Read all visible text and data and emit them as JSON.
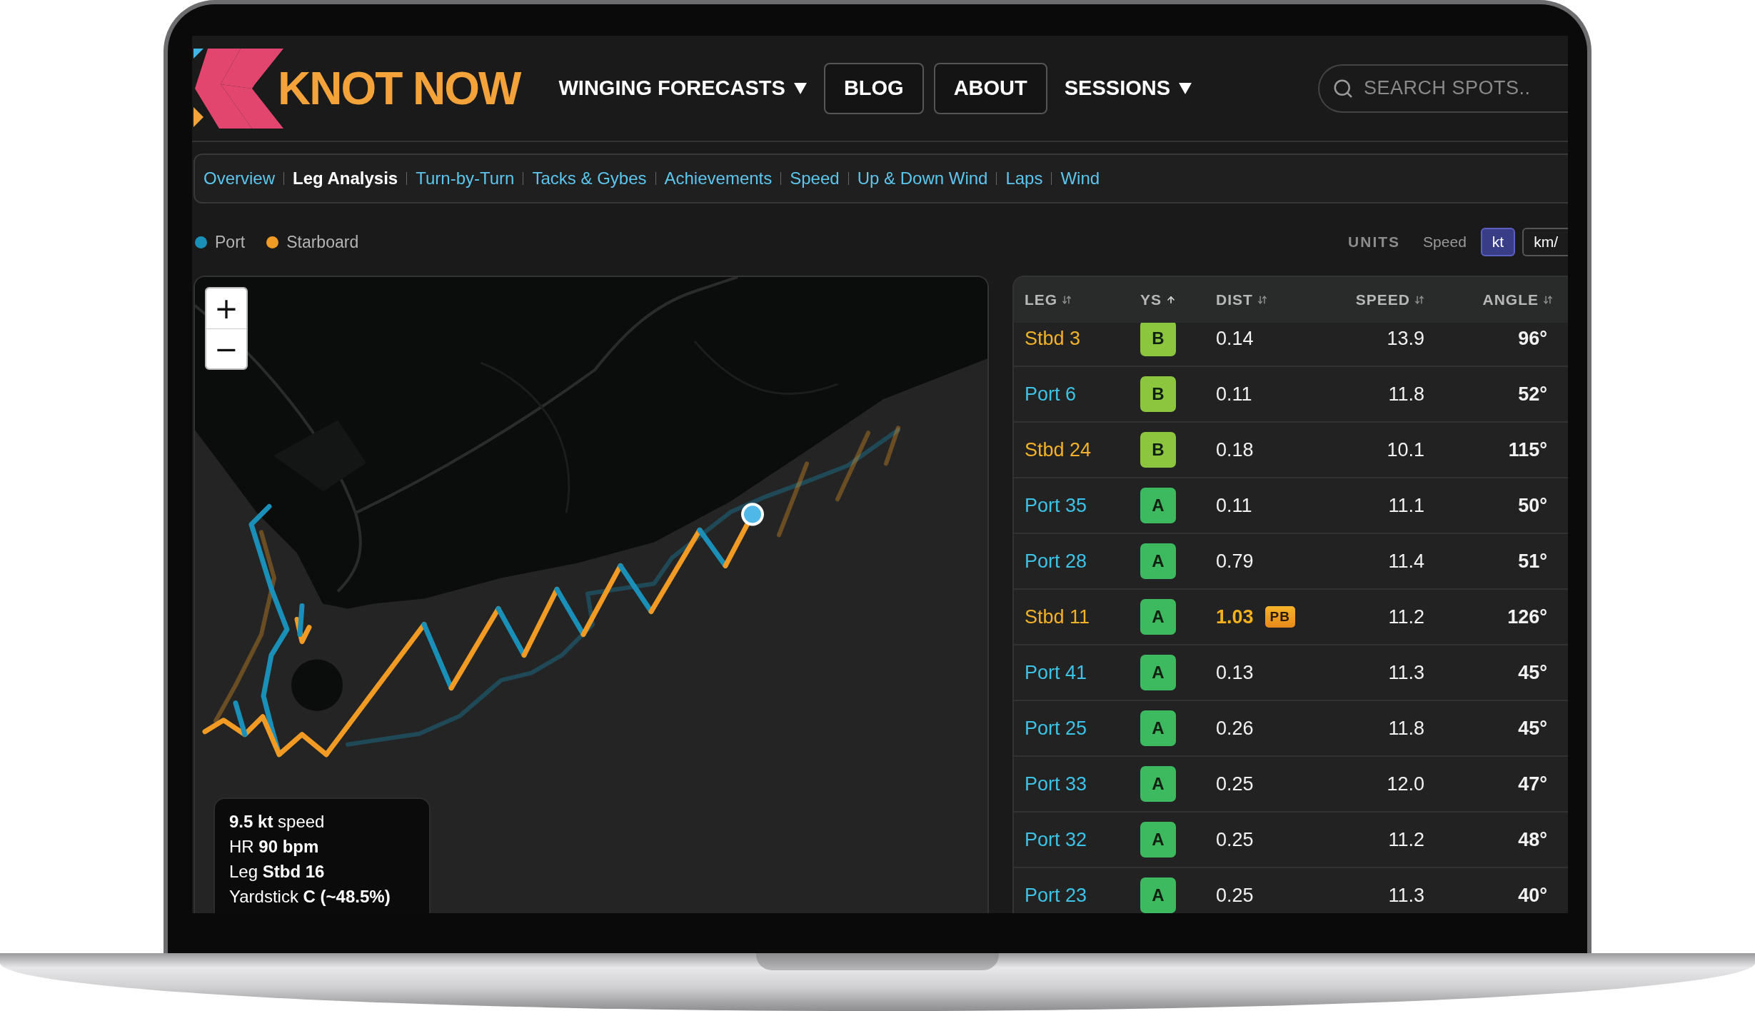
{
  "brand": {
    "name": "KNOT NOW"
  },
  "nav": [
    {
      "label": "WINGING FORECASTS",
      "kind": "menu"
    },
    {
      "label": "BLOG",
      "kind": "button"
    },
    {
      "label": "ABOUT",
      "kind": "button"
    },
    {
      "label": "SESSIONS",
      "kind": "menu"
    }
  ],
  "search": {
    "placeholder": "SEARCH SPOTS.."
  },
  "tabs": [
    {
      "label": "Overview",
      "selected": false
    },
    {
      "label": "Leg Analysis",
      "selected": true
    },
    {
      "label": "Turn-by-Turn",
      "selected": false
    },
    {
      "label": "Tacks & Gybes",
      "selected": false
    },
    {
      "label": "Achievements",
      "selected": false
    },
    {
      "label": "Speed",
      "selected": false
    },
    {
      "label": "Up & Down Wind",
      "selected": false
    },
    {
      "label": "Laps",
      "selected": false
    },
    {
      "label": "Wind",
      "selected": false
    }
  ],
  "legend": [
    {
      "label": "Port",
      "color": "#1a90b8"
    },
    {
      "label": "Starboard",
      "color": "#f29b24"
    }
  ],
  "units": {
    "label": "UNITS",
    "field": "Speed",
    "options": [
      {
        "label": "kt",
        "selected": true
      },
      {
        "label": "km/",
        "selected": false
      }
    ]
  },
  "map": {
    "zoom_in": "+",
    "zoom_out": "−",
    "info": [
      "**9.5 kt** speed",
      "HR **90 bpm**",
      "Leg **Stbd 16**",
      "Yardstick **C (~48.5%)**"
    ]
  },
  "table": {
    "columns": [
      {
        "label": "LEG",
        "sorted": false
      },
      {
        "label": "YS",
        "sorted": true
      },
      {
        "label": "DIST",
        "sorted": false
      },
      {
        "label": "SPEED",
        "sorted": false
      },
      {
        "label": "ANGLE",
        "sorted": false
      }
    ],
    "rows": [
      {
        "leg": "Stbd 3",
        "starboard": true,
        "ys": {
          "grade": "B",
          "color": "#8cc63f"
        },
        "dist": "0.14",
        "speed": "13.9",
        "angle": "96°"
      },
      {
        "leg": "Port 6",
        "starboard": false,
        "ys": {
          "grade": "B",
          "color": "#8cc63f"
        },
        "dist": "0.11",
        "speed": "11.8",
        "angle": "52°"
      },
      {
        "leg": "Stbd 24",
        "starboard": true,
        "ys": {
          "grade": "B",
          "color": "#8cc63f"
        },
        "dist": "0.18",
        "speed": "10.1",
        "angle": "115°"
      },
      {
        "leg": "Port 35",
        "starboard": false,
        "ys": {
          "grade": "A",
          "color": "#3dba5f"
        },
        "dist": "0.11",
        "speed": "11.1",
        "angle": "50°"
      },
      {
        "leg": "Port 28",
        "starboard": false,
        "ys": {
          "grade": "A",
          "color": "#3dba5f"
        },
        "dist": "0.79",
        "speed": "11.4",
        "angle": "51°"
      },
      {
        "leg": "Stbd 11",
        "starboard": true,
        "ys": {
          "grade": "A",
          "color": "#3dba5f"
        },
        "dist": "1.03",
        "badge": "PB",
        "speed": "11.2",
        "angle": "126°"
      },
      {
        "leg": "Port 41",
        "starboard": false,
        "ys": {
          "grade": "A",
          "color": "#3dba5f"
        },
        "dist": "0.13",
        "speed": "11.3",
        "angle": "45°"
      },
      {
        "leg": "Port 25",
        "starboard": false,
        "ys": {
          "grade": "A",
          "color": "#3dba5f"
        },
        "dist": "0.26",
        "speed": "11.8",
        "angle": "45°"
      },
      {
        "leg": "Port 33",
        "starboard": false,
        "ys": {
          "grade": "A",
          "color": "#3dba5f"
        },
        "dist": "0.25",
        "speed": "12.0",
        "angle": "47°"
      },
      {
        "leg": "Port 32",
        "starboard": false,
        "ys": {
          "grade": "A",
          "color": "#3dba5f"
        },
        "dist": "0.25",
        "speed": "11.2",
        "angle": "48°"
      },
      {
        "leg": "Port 23",
        "starboard": false,
        "ys": {
          "grade": "A",
          "color": "#3dba5f"
        },
        "dist": "0.25",
        "speed": "11.3",
        "angle": "40°"
      }
    ]
  }
}
